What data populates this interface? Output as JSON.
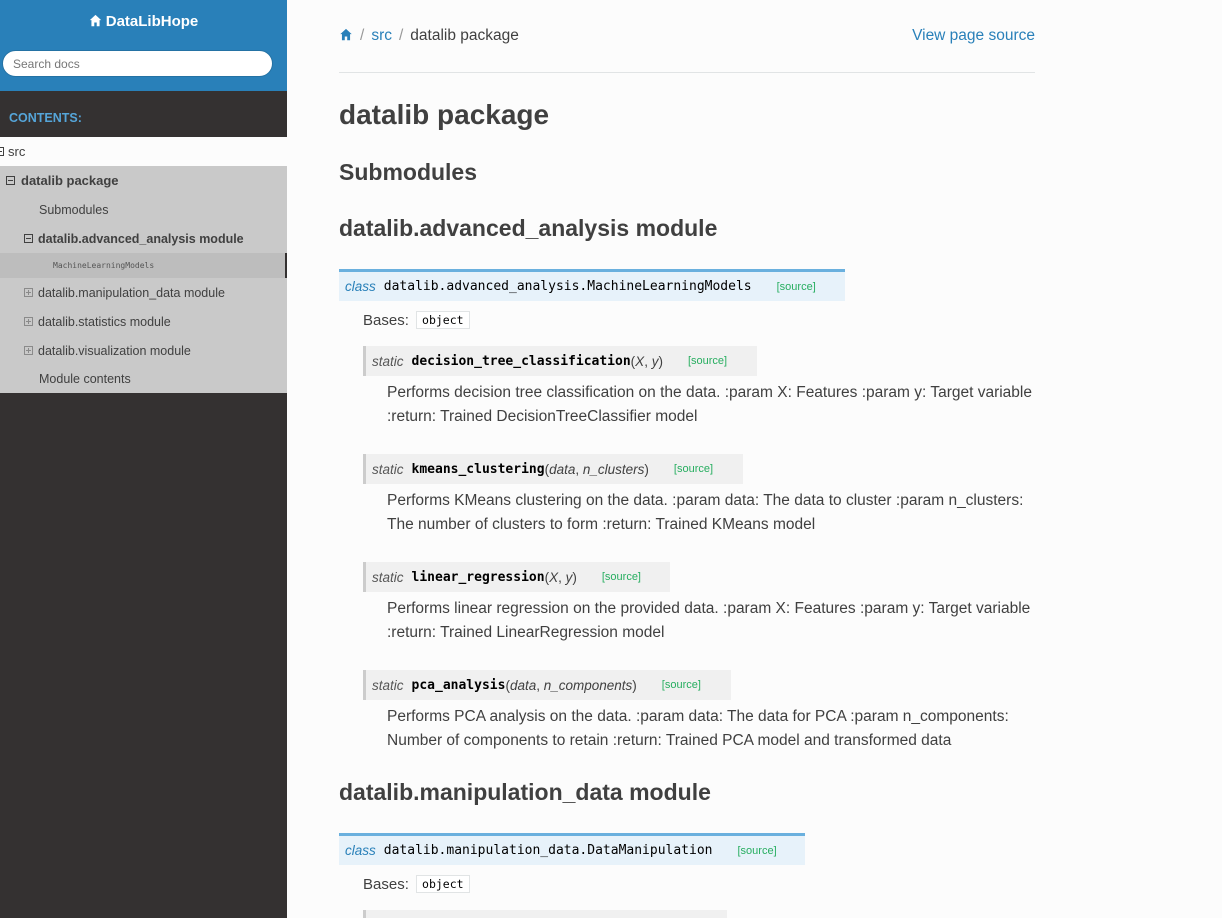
{
  "sidebar": {
    "brand": "DataLibHope",
    "search_placeholder": "Search docs",
    "caption": "CONTENTS:",
    "items": {
      "src": "src",
      "pkg": "datalib package",
      "submodules": "Submodules",
      "adv": "datalib.advanced_analysis module",
      "ml": "MachineLearningModels",
      "manip": "datalib.manipulation_data module",
      "stats": "datalib.statistics module",
      "viz": "datalib.visualization module",
      "contents": "Module contents"
    }
  },
  "breadcrumb": {
    "src": "src",
    "current": "datalib package",
    "view_source": "View page source"
  },
  "page": {
    "title": "datalib package",
    "submodules_heading": "Submodules",
    "adv_heading": "datalib.advanced_analysis module",
    "manip_heading": "datalib.manipulation_data module"
  },
  "class1": {
    "keyword": "class",
    "name": "datalib.advanced_analysis.MachineLearningModels",
    "source": "[source]",
    "bases_label": "Bases:",
    "bases_value": "object"
  },
  "methods": [
    {
      "static": "static",
      "name": "decision_tree_classification",
      "open": "(",
      "p1": "X",
      "sep": ", ",
      "p2": "y",
      "close": ")",
      "source": "[source]",
      "desc": "Performs decision tree classification on the data. :param X: Features :param y: Target variable :return: Trained DecisionTreeClassifier model"
    },
    {
      "static": "static",
      "name": "kmeans_clustering",
      "open": "(",
      "p1": "data",
      "sep": ", ",
      "p2": "n_clusters",
      "close": ")",
      "source": "[source]",
      "desc": "Performs KMeans clustering on the data. :param data: The data to cluster :param n_clusters: The number of clusters to form :return: Trained KMeans model"
    },
    {
      "static": "static",
      "name": "linear_regression",
      "open": "(",
      "p1": "X",
      "sep": ", ",
      "p2": "y",
      "close": ")",
      "source": "[source]",
      "desc": "Performs linear regression on the provided data. :param X: Features :param y: Target variable :return: Trained LinearRegression model"
    },
    {
      "static": "static",
      "name": "pca_analysis",
      "open": "(",
      "p1": "data",
      "sep": ", ",
      "p2": "n_components",
      "close": ")",
      "source": "[source]",
      "desc": "Performs PCA analysis on the data. :param data: The data for PCA :param n_components: Number of components to retain :return: Trained PCA model and transformed data"
    }
  ],
  "class2": {
    "keyword": "class",
    "name": "datalib.manipulation_data.DataManipulation",
    "source": "[source]",
    "bases_label": "Bases:",
    "bases_value": "object"
  },
  "colors": {
    "brand_blue": "#2980b9",
    "sidebar_dark": "#343131",
    "source_green": "#27ae60",
    "sig_bg": "#e7f2fa",
    "sig_border": "#6ab0de"
  }
}
